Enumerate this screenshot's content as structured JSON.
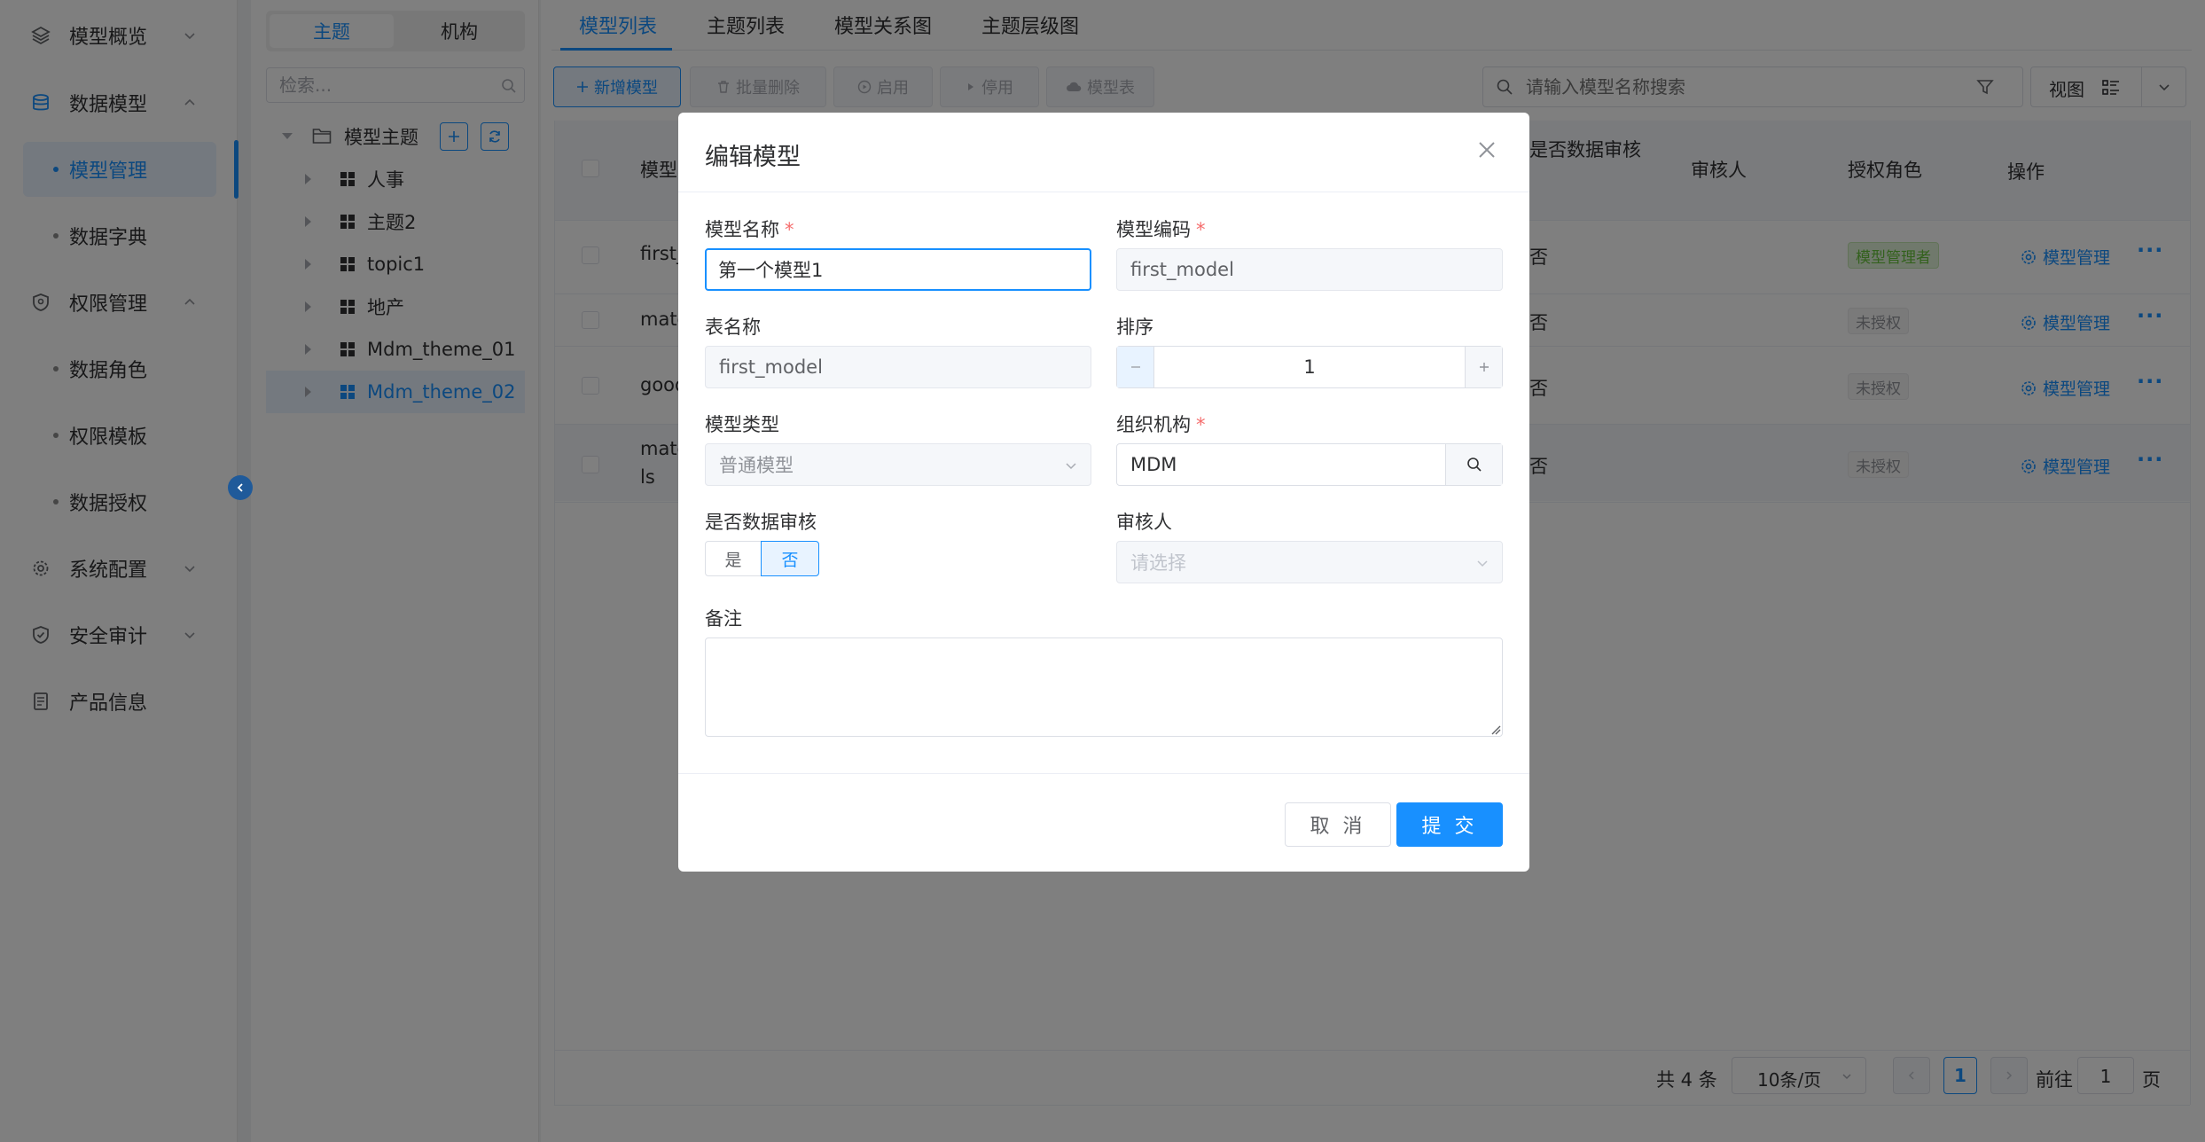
{
  "sidebar": {
    "items": [
      {
        "label": "模型概览"
      },
      {
        "label": "数据模型"
      },
      {
        "label": "模型管理"
      },
      {
        "label": "数据字典"
      },
      {
        "label": "权限管理"
      },
      {
        "label": "数据角色"
      },
      {
        "label": "权限模板"
      },
      {
        "label": "数据授权"
      },
      {
        "label": "系统配置"
      },
      {
        "label": "安全审计"
      },
      {
        "label": "产品信息"
      }
    ],
    "active": "模型管理"
  },
  "tree": {
    "segments": [
      "主题",
      "机构"
    ],
    "active_segment": "主题",
    "search_placeholder": "检索...",
    "root": "模型主题",
    "nodes": [
      "人事",
      "主题2",
      "topic1",
      "地产",
      "Mdm_theme_01",
      "Mdm_theme_02"
    ],
    "selected": "Mdm_theme_02"
  },
  "main": {
    "tabs": [
      "模型列表",
      "主题列表",
      "模型关系图",
      "主题层级图"
    ],
    "active_tab": "模型列表",
    "toolbar": {
      "add": "新增模型",
      "batch_delete": "批量删除",
      "enable": "启用",
      "disable": "停用",
      "model_table": "模型表"
    },
    "search_placeholder": "请输入模型名称搜索",
    "view_label": "视图",
    "columns": {
      "model": "模型",
      "audit": "是否数据审核",
      "reviewer": "审核人",
      "role": "授权角色",
      "ops": "操作"
    },
    "rows": [
      {
        "name": "first_",
        "audit": "否",
        "role": "模型管理者",
        "op": "模型管理"
      },
      {
        "name": "mate",
        "audit": "否",
        "role": "未授权",
        "op": "模型管理"
      },
      {
        "name": "good",
        "audit": "否",
        "role": "未授权",
        "op": "模型管理"
      },
      {
        "name": "mate",
        "name2": "ls",
        "audit": "否",
        "role": "未授权",
        "op": "模型管理"
      }
    ],
    "pagination": {
      "total": "共 4 条",
      "page_size": "10条/页",
      "current": "1",
      "goto_label": "前往",
      "goto_value": "1",
      "page_suffix": "页"
    }
  },
  "dialog": {
    "title": "编辑模型",
    "fields": {
      "model_name": {
        "label": "模型名称",
        "value": "第一个模型1"
      },
      "model_code": {
        "label": "模型编码",
        "value": "first_model"
      },
      "table_name": {
        "label": "表名称",
        "value": "first_model"
      },
      "sort": {
        "label": "排序",
        "value": "1"
      },
      "model_type": {
        "label": "模型类型",
        "value": "普通模型"
      },
      "org": {
        "label": "组织机构",
        "value": "MDM"
      },
      "data_audit": {
        "label": "是否数据审核",
        "options": [
          "是",
          "否"
        ],
        "selected": "否"
      },
      "reviewer": {
        "label": "审核人",
        "placeholder": "请选择"
      },
      "remark": {
        "label": "备注",
        "value": ""
      }
    },
    "required_mark": "*",
    "cancel": "取 消",
    "submit": "提 交"
  },
  "colors": {
    "primary": "#1890ff",
    "required": "#f56c6c",
    "mask": "rgba(0,0,0,0.5)"
  }
}
